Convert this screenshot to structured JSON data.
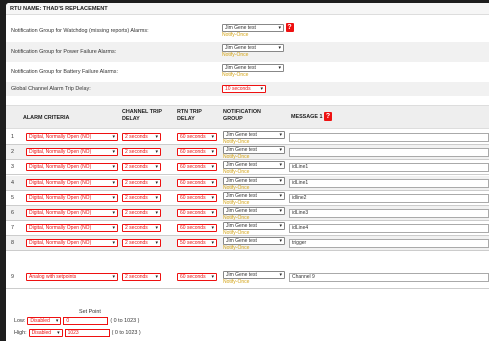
{
  "title": "RTU NAME: THAD'S REPLACEMENT",
  "globals": {
    "watchdog_label": "Notification Group for Watchdog (missing reports) Alarms:",
    "power_label": "Notification Group for Power Failure Alarms:",
    "battery_label": "Notification Group for Battery Failure Alarms:",
    "trip_label": "Global Channel Alarm Trip Delay:",
    "group_value": "Jim Gene test",
    "notify_once": "Notify-Once",
    "trip_value": "10 seconds",
    "help_glyph": "?"
  },
  "table": {
    "headers": {
      "criteria": "ALARM CRITERIA",
      "channel_trip": "CHANNEL TRIP",
      "channel_trip2": "DELAY",
      "rtn_trip": "RTN TRIP",
      "rtn_trip2": "DELAY",
      "notification": "NOTIFICATION",
      "notification2": "GROUP",
      "message": "MESSAGE 1"
    },
    "rows": [
      {
        "num": "1",
        "criteria": "Digital, Normally Open (NO)",
        "trip": "2 seconds",
        "rtn": "60 seconds",
        "group": "Jim Gene test",
        "notify": "Notify-Once",
        "message": ""
      },
      {
        "num": "2",
        "criteria": "Digital, Normally Open (NO)",
        "trip": "2 seconds",
        "rtn": "60 seconds",
        "group": "Jim Gene test",
        "notify": "Notify-Once",
        "message": ""
      },
      {
        "num": "3",
        "criteria": "Digital, Normally Open (NO)",
        "trip": "2 seconds",
        "rtn": "60 seconds",
        "group": "Jim Gene test",
        "notify": "Notify-Once",
        "message": "idLine1"
      },
      {
        "num": "4",
        "criteria": "Digital, Normally Open (NO)",
        "trip": "2 seconds",
        "rtn": "60 seconds",
        "group": "Jim Gene test",
        "notify": "Notify-Once",
        "message": "idLine1"
      },
      {
        "num": "5",
        "criteria": "Digital, Normally Open (NO)",
        "trip": "2 seconds",
        "rtn": "60 seconds",
        "group": "Jim Gene test",
        "notify": "Notify-Once",
        "message": "idline2"
      },
      {
        "num": "6",
        "criteria": "Digital, Normally Open (NO)",
        "trip": "2 seconds",
        "rtn": "60 seconds",
        "group": "Jim Gene test",
        "notify": "Notify-Once",
        "message": "idLine3"
      },
      {
        "num": "7",
        "criteria": "Digital, Normally Open (NO)",
        "trip": "2 seconds",
        "rtn": "60 seconds",
        "group": "Jim Gene test",
        "notify": "Notify-Once",
        "message": "idLine4"
      },
      {
        "num": "8",
        "criteria": "Digital, Normally Open (NO)",
        "trip": "2 seconds",
        "rtn": "50 seconds",
        "group": "Jim Gene test",
        "notify": "Notify-Once",
        "message": "trigger"
      },
      {
        "num": "9",
        "criteria": "Analog with setpoints",
        "trip": "2 seconds",
        "rtn": "60 seconds",
        "group": "Jim Gene test",
        "notify": "Notify-Once",
        "message": "Channel 9"
      }
    ]
  },
  "setpoint": {
    "title": "Set Point",
    "low_label": "Low:",
    "low_state": "Disabled",
    "low_value": "0",
    "low_range": "( 0 to 1023 )",
    "high_label": "High:",
    "high_state": "Disabled",
    "high_value": "1023",
    "high_range": "( 0 to 1023 )"
  }
}
